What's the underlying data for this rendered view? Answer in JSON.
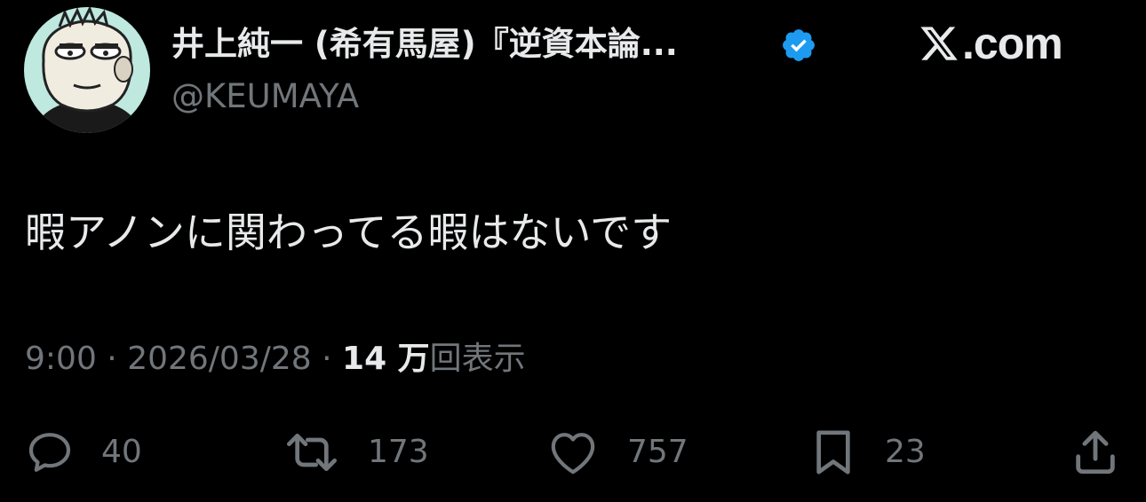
{
  "profile": {
    "display_name": "井上純一 (希有馬屋)『逆資本論...",
    "handle": "@KEUMAYA",
    "avatar_icon": "cartoon-face-avatar",
    "verified_icon": "verified-badge-icon",
    "verified_color": "#1d9bf0"
  },
  "brand": {
    "logo_icon": "x-logo-icon",
    "text": ".com"
  },
  "tweet": {
    "text": "暇アノンに関わってる暇はないです"
  },
  "meta": {
    "time": "9:00",
    "separator1": " · ",
    "date": "2026/03/28",
    "separator2": " · ",
    "views_count": "14 万",
    "views_label": "回表示"
  },
  "actions": {
    "reply": {
      "icon": "reply-icon",
      "count": "40"
    },
    "retweet": {
      "icon": "retweet-icon",
      "count": "173"
    },
    "like": {
      "icon": "heart-icon",
      "count": "757"
    },
    "bookmark": {
      "icon": "bookmark-icon",
      "count": "23"
    },
    "share": {
      "icon": "share-icon"
    }
  },
  "colors": {
    "background": "#000000",
    "primary_text": "#e7e9ea",
    "secondary_text": "#71767b",
    "avatar_bg": "#bfe8df"
  }
}
